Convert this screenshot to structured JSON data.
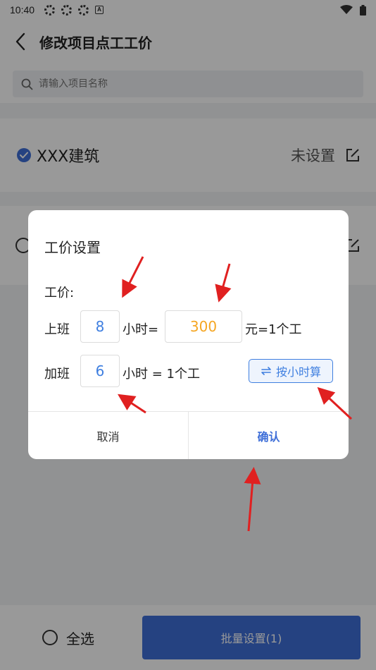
{
  "status_bar": {
    "time": "10:40",
    "badge": "A"
  },
  "header": {
    "title": "修改项目点工工价"
  },
  "search": {
    "placeholder": "请输入项目名称"
  },
  "list": {
    "items": [
      {
        "name": "XXX建筑",
        "status": "未设置",
        "checked": true
      }
    ]
  },
  "bottom": {
    "select_all": "全选",
    "batch": "批量设置(1)"
  },
  "dialog": {
    "title": "工价设置",
    "wage_label": "工价:",
    "regular_label": "上班",
    "regular_hours": "8",
    "hours_eq": "小时=",
    "wage_value": "300",
    "yuan_eq": "元=1个工",
    "overtime_label": "加班",
    "overtime_hours": "6",
    "ot_eq": "小时 = 1个工",
    "hourly_button": "按小时算",
    "cancel": "取消",
    "confirm": "确认"
  },
  "colors": {
    "accent": "#3f6fd8",
    "wage": "#f5a623",
    "annotation": "#e02020"
  }
}
